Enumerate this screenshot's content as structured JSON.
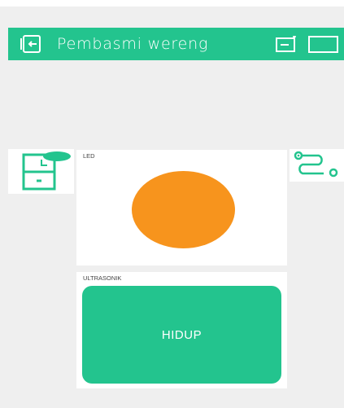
{
  "header": {
    "title": "Pembasmi wereng",
    "icons": [
      "back-exit-icon",
      "battery-icon",
      "rectangle-icon"
    ],
    "color": "#23c48e"
  },
  "side_left": {
    "icon": "panel-cabinet-icon"
  },
  "side_right": {
    "icon": "route-flow-icon"
  },
  "widgets": {
    "led": {
      "label": "LED",
      "color": "#f7941d"
    },
    "ultrasonik": {
      "label": "ULTRASONIK",
      "button_label": "HIDUP"
    }
  }
}
